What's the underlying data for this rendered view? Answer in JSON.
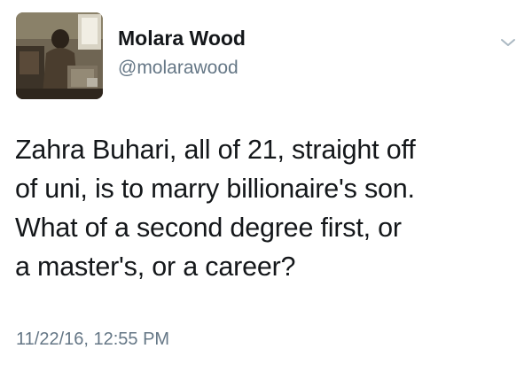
{
  "tweet": {
    "author": {
      "display_name": "Molara Wood",
      "handle": "@molarawood",
      "avatar_icon": "user-photo-avatar"
    },
    "menu_icon": "chevron-down-icon",
    "text": "Zahra Buhari, all of 21, straight off\nof uni, is to marry billionaire's son.\nWhat of a second degree first, or\na master's, or a career?",
    "timestamp": "11/22/16, 12:55 PM"
  },
  "colors": {
    "text_primary": "#14171a",
    "text_secondary": "#657786",
    "chevron": "#aab8c2",
    "background": "#ffffff"
  }
}
